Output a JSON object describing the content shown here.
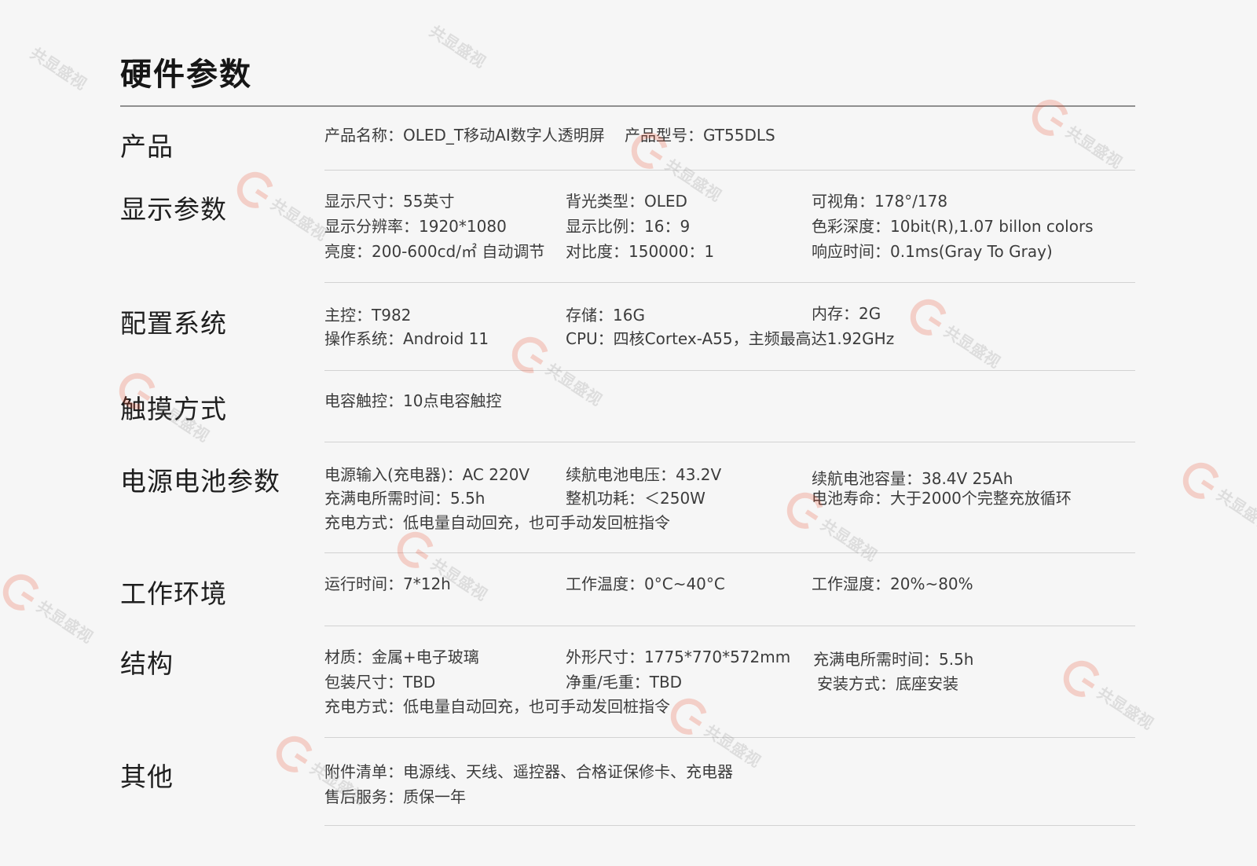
{
  "page": {
    "title": "硬件参数"
  },
  "watermark": {
    "text": "共显盛视",
    "accent_color": "#e94a2a",
    "icon": "g-logo-icon"
  },
  "sections": {
    "product": {
      "label": "产品",
      "items": [
        "产品名称：OLED_T移动AI数字人透明屏",
        "产品型号：GT55DLS"
      ]
    },
    "display": {
      "label": "显示参数",
      "items": [
        "显示尺寸：55英寸",
        "背光类型：OLED",
        "可视角：178°/178",
        "显示分辨率：1920*1080",
        "显示比例：16：9",
        "色彩深度：10bit(R),1.07 billon colors",
        "亮度：200-600cd/㎡ 自动调节",
        "对比度：150000：1",
        "响应时间：0.1ms(Gray To Gray)"
      ]
    },
    "config": {
      "label": "配置系统",
      "items": [
        "主控：T982",
        "存储：16G",
        "内存：2G",
        "操作系统：Android 11",
        "CPU：四核Cortex-A55，主频最高达1.92GHz"
      ]
    },
    "touch": {
      "label": "触摸方式",
      "items": [
        "电容触控：10点电容触控"
      ]
    },
    "power": {
      "label": "电源电池参数",
      "items": [
        "电源输入(充电器)：AC 220V",
        "续航电池电压：43.2V",
        "续航电池容量：38.4V 25Ah",
        "充满电所需时间：5.5h",
        "整机功耗：＜250W",
        "电池寿命：大于2000个完整充放循环",
        "充电方式：低电量自动回充，也可手动发回桩指令"
      ]
    },
    "env": {
      "label": "工作环境",
      "items": [
        "运行时间：7*12h",
        "工作温度：0°C~40°C",
        "工作湿度：20%~80%"
      ]
    },
    "structure": {
      "label": "结构",
      "items": [
        "材质：金属+电子玻璃",
        "外形尺寸：1775*770*572mm",
        "充满电所需时间：5.5h",
        "包装尺寸：TBD",
        "净重/毛重：TBD",
        "安装方式：底座安装",
        "充电方式：低电量自动回充，也可手动发回桩指令"
      ]
    },
    "other": {
      "label": "其他",
      "items": [
        "附件清单：电源线、天线、遥控器、合格证保修卡、充电器",
        "售后服务：质保一年"
      ]
    }
  }
}
